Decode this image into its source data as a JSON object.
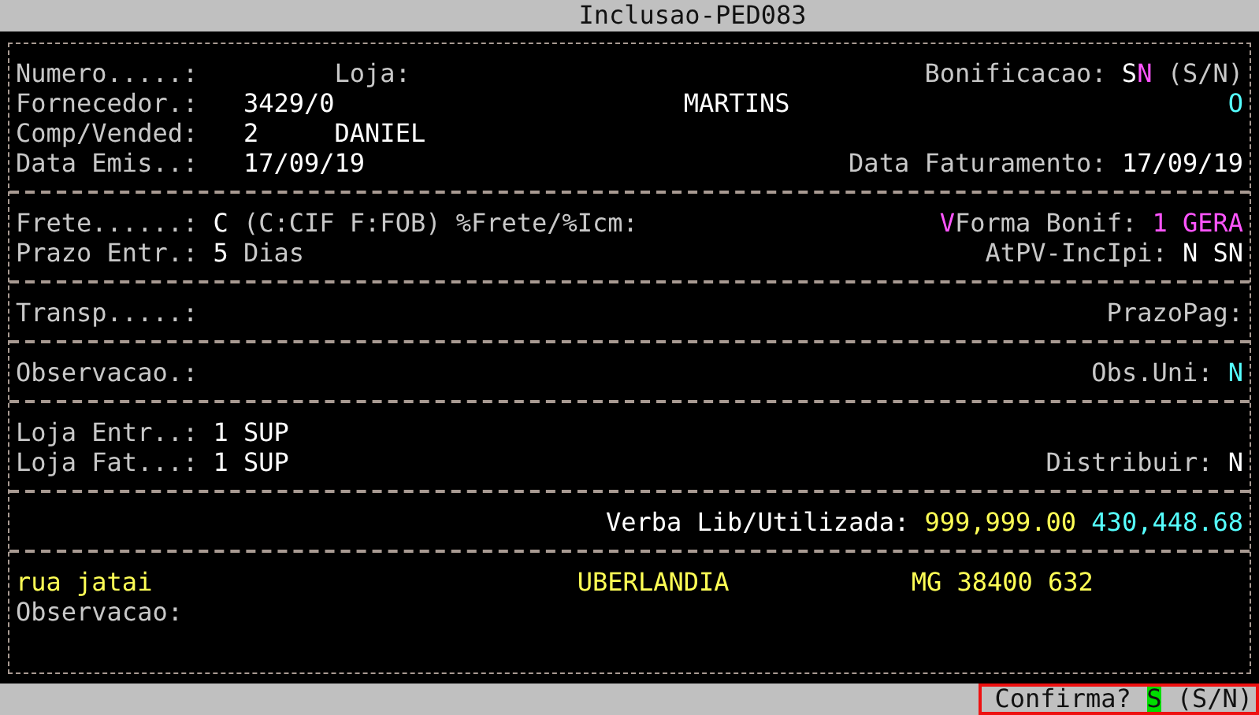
{
  "window": {
    "title": "Inclusao-PED083"
  },
  "sections": [
    {
      "kind": "header",
      "rows": [
        {
          "left": [
            {
              "kind": "label",
              "text": "Numero.....:"
            }
          ],
          "center": [
            {
              "kind": "label",
              "text": "Loja:"
            }
          ],
          "right": [
            {
              "kind": "label",
              "text": "Bonificacao:"
            },
            {
              "kind": "value",
              "parts": [
                {
                  "text": "S"
                },
                {
                  "text": "N",
                  "color": "#ff55ff"
                }
              ]
            },
            {
              "kind": "label",
              "text": "(S/N)"
            }
          ]
        },
        {
          "left": [
            {
              "kind": "label",
              "text": "Fornecedor.:"
            },
            {
              "kind": "value",
              "text": "3429/0"
            }
          ],
          "center2": [
            {
              "kind": "value",
              "text": "MARTINS"
            }
          ],
          "right": [
            {
              "kind": "value",
              "text": "O",
              "color": "#55ffff"
            }
          ]
        },
        {
          "left": [
            {
              "kind": "label",
              "text": "Comp/Vended:"
            },
            {
              "kind": "value",
              "text": "2"
            }
          ],
          "center": [
            {
              "kind": "value",
              "text": "DANIEL"
            }
          ]
        },
        {
          "left": [
            {
              "kind": "label",
              "text": "Data Emis..:"
            },
            {
              "kind": "value",
              "text": "17/09/19"
            }
          ],
          "right": [
            {
              "kind": "label",
              "text": "Data Faturamento:"
            },
            {
              "kind": "value",
              "text": "17/09/19"
            }
          ]
        }
      ]
    },
    {
      "kind": "plain",
      "rows": [
        {
          "left": [
            {
              "kind": "label",
              "text": "Frete......:"
            },
            {
              "kind": "value",
              "text": "C"
            },
            {
              "kind": "label",
              "text": "(C:CIF F:FOB)"
            },
            {
              "kind": "label",
              "text": "%Frete/%Icm:"
            }
          ],
          "right": [
            {
              "kind": "label",
              "parts": [
                {
                  "text": "V",
                  "color": "#ff55ff"
                },
                {
                  "text": "Forma Bonif:"
                }
              ]
            },
            {
              "kind": "value",
              "text": "1 GERA",
              "color": "#ff55ff"
            }
          ]
        },
        {
          "left": [
            {
              "kind": "label",
              "text": "Prazo Entr.:"
            },
            {
              "kind": "value",
              "text": "5"
            },
            {
              "kind": "label",
              "text": "Dias"
            }
          ],
          "right": [
            {
              "kind": "label",
              "text": "AtPV-IncIpi:"
            },
            {
              "kind": "value",
              "text": "N"
            },
            {
              "kind": "value",
              "text": "SN"
            }
          ]
        }
      ]
    },
    {
      "kind": "plain",
      "rows": [
        {
          "left": [
            {
              "kind": "label",
              "text": "Transp.....:"
            }
          ],
          "right": [
            {
              "kind": "label",
              "text": "PrazoPag:"
            }
          ]
        }
      ]
    },
    {
      "kind": "plain",
      "rows": [
        {
          "left": [
            {
              "kind": "label",
              "text": "Observacao.:"
            }
          ],
          "right": [
            {
              "kind": "label",
              "text": "Obs.Uni:"
            },
            {
              "kind": "value",
              "text": "N",
              "color": "#55ffff"
            }
          ]
        }
      ]
    },
    {
      "kind": "plain",
      "rows": [
        {
          "left": [
            {
              "kind": "label",
              "text": "Loja Entr..:"
            },
            {
              "kind": "value",
              "text": "1"
            },
            {
              "kind": "value",
              "text": "SUP"
            }
          ]
        },
        {
          "left": [
            {
              "kind": "label",
              "text": "Loja Fat...:"
            },
            {
              "kind": "value",
              "text": "1"
            },
            {
              "kind": "value",
              "text": "SUP"
            }
          ],
          "right": [
            {
              "kind": "label",
              "text": "Distribuir:"
            },
            {
              "kind": "value",
              "text": "N"
            }
          ]
        }
      ]
    },
    {
      "kind": "plain",
      "rows": [
        {
          "right": [
            {
              "kind": "value",
              "text": "Verba Lib/Utilizada:"
            },
            {
              "kind": "value",
              "text": "999,999.00",
              "color": "#ffff55"
            },
            {
              "kind": "value",
              "text": "430,448.68",
              "color": "#55ffff"
            }
          ]
        }
      ]
    },
    {
      "kind": "address",
      "rows": [
        {
          "left": [
            {
              "kind": "value",
              "text": "rua jatai",
              "color": "#ffff55"
            }
          ],
          "center": [
            {
              "kind": "value",
              "text": "UBERLANDIA",
              "color": "#ffff55"
            }
          ],
          "center2": [
            {
              "kind": "value",
              "text": "MG 38400 632",
              "color": "#ffff55"
            }
          ]
        },
        {
          "left": [
            {
              "kind": "label",
              "text": "Observacao:"
            }
          ]
        },
        {}
      ]
    }
  ],
  "status_bar": {
    "prompt": "Confirma?",
    "answer": "S",
    "hint": "(S/N)",
    "highlighted": true
  }
}
